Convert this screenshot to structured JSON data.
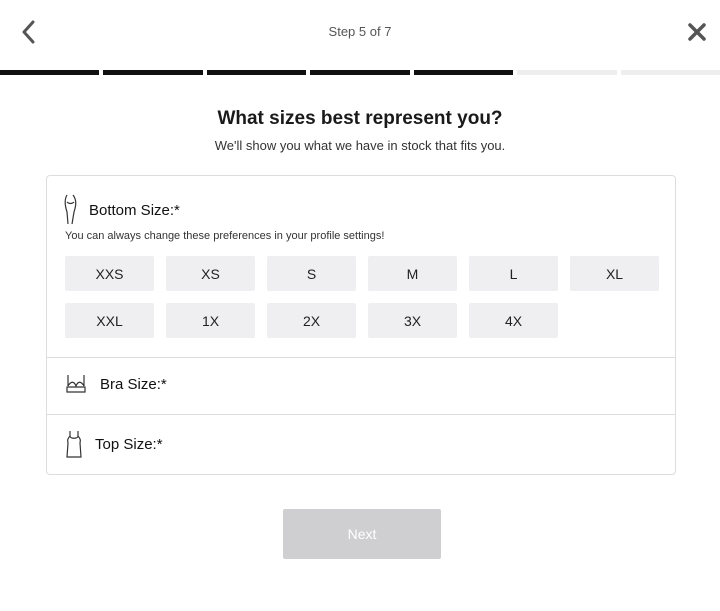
{
  "header": {
    "step_label": "Step 5 of 7",
    "back_icon": "chevron-left-icon",
    "close_icon": "close-icon"
  },
  "progress": {
    "total_steps": 7,
    "completed_steps": 5,
    "done_color": "#111111",
    "todo_color": "#eeeeee"
  },
  "main": {
    "title": "What sizes best represent you?",
    "subtitle": "We'll show you what we have in stock that fits you."
  },
  "bottom_size": {
    "label": "Bottom Size:*",
    "note": "You can always change these preferences in your profile settings!",
    "icon": "legs-icon",
    "options": [
      "XXS",
      "XS",
      "S",
      "M",
      "L",
      "XL",
      "XXL",
      "1X",
      "2X",
      "3X",
      "4X"
    ]
  },
  "bra_size": {
    "label": "Bra Size:*",
    "icon": "bra-icon"
  },
  "top_size": {
    "label": "Top Size:*",
    "icon": "tank-top-icon"
  },
  "footer": {
    "next_label": "Next",
    "next_bg": "#cfced1"
  }
}
